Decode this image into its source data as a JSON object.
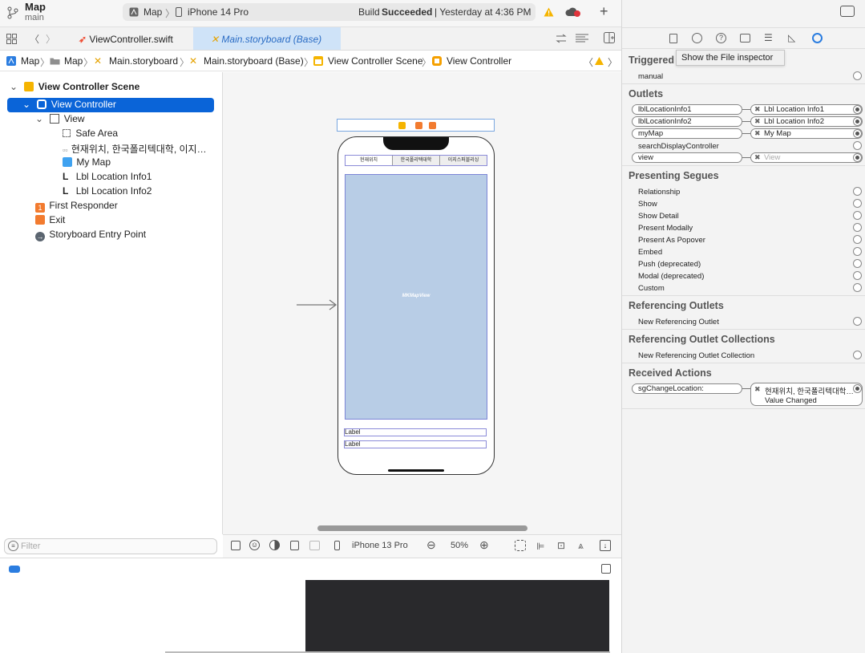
{
  "toolbar": {
    "project": "Map",
    "branch": "main",
    "scheme_app": "Map",
    "scheme_device": "iPhone 14 Pro",
    "build_prefix": "Build ",
    "build_status": "Succeeded",
    "build_time": "| Yesterday at 4:36 PM"
  },
  "tabs": [
    {
      "label": "ViewController.swift"
    },
    {
      "label": "Main.storyboard (Base)"
    }
  ],
  "breadcrumbs": [
    "Map",
    "Map",
    "Main.storyboard",
    "Main.storyboard (Base)",
    "View Controller Scene",
    "View Controller"
  ],
  "outline": {
    "scene": "View Controller Scene",
    "vc": "View Controller",
    "view": "View",
    "safe_area": "Safe Area",
    "segmented": "현재위치, 한국폴리텍대학, 이지…",
    "map": "My Map",
    "lbl1": "Lbl Location Info1",
    "lbl2": "Lbl Location Info2",
    "first_responder": "First Responder",
    "exit": "Exit",
    "entry": "Storyboard Entry Point"
  },
  "filter_placeholder": "Filter",
  "device": {
    "segments": [
      "현재위치",
      "한국폴리텍대학",
      "이지스퍼블리싱"
    ],
    "map_label": "MKMapView",
    "label1": "Label",
    "label2": "Label"
  },
  "canvas_bar": {
    "device": "iPhone 13 Pro",
    "zoom": "50%"
  },
  "inspector": {
    "tooltip": "Show the File inspector",
    "triggered": "Triggered",
    "manual": "manual",
    "outlets_title": "Outlets",
    "outlets": [
      {
        "name": "lblLocationInfo1",
        "target": "Lbl Location Info1"
      },
      {
        "name": "lblLocationInfo2",
        "target": "Lbl Location Info2"
      },
      {
        "name": "myMap",
        "target": "My Map"
      },
      {
        "name": "searchDisplayController",
        "target": ""
      },
      {
        "name": "view",
        "target": "View"
      }
    ],
    "segues_title": "Presenting Segues",
    "segues": [
      "Relationship",
      "Show",
      "Show Detail",
      "Present Modally",
      "Present As Popover",
      "Embed",
      "Push (deprecated)",
      "Modal (deprecated)",
      "Custom"
    ],
    "ref_outlets_title": "Referencing Outlets",
    "new_ref_outlet": "New Referencing Outlet",
    "ref_coll_title": "Referencing Outlet Collections",
    "new_ref_coll": "New Referencing Outlet Collection",
    "actions_title": "Received Actions",
    "action_name": "sgChangeLocation:",
    "action_target": "현재위치, 한국폴리텍대학…",
    "action_event": "Value Changed"
  },
  "colors": {
    "accent": "#0a64d8",
    "map_fill": "#b8cde6",
    "warning": "#f5b400"
  }
}
